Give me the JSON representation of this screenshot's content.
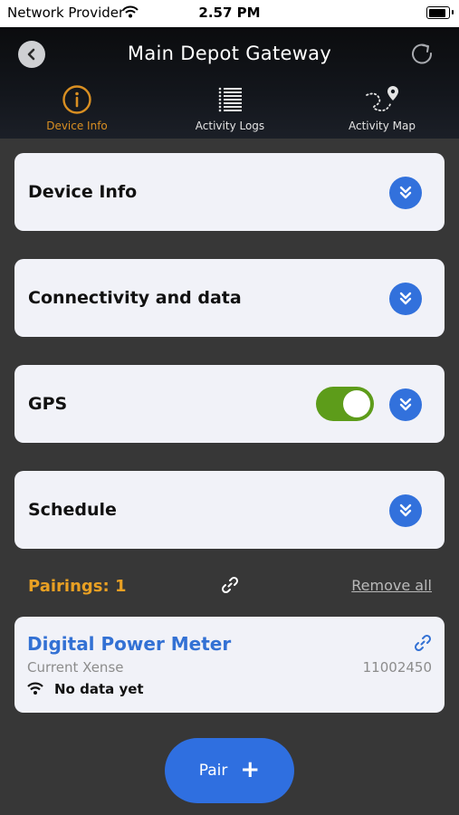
{
  "status_bar": {
    "carrier": "Network Provider",
    "time": "2.57 PM"
  },
  "header": {
    "title": "Main Depot Gateway",
    "tabs": [
      {
        "label": "Device Info",
        "icon": "info-icon",
        "active": true
      },
      {
        "label": "Activity Logs",
        "icon": "list-icon",
        "active": false
      },
      {
        "label": "Activity Map",
        "icon": "map-route-icon",
        "active": false
      }
    ]
  },
  "sections": [
    {
      "title": "Device Info"
    },
    {
      "title": "Connectivity and data"
    },
    {
      "title": "GPS",
      "toggle_on": true
    },
    {
      "title": "Schedule"
    }
  ],
  "pairings": {
    "label": "Pairings: 1",
    "remove_all": "Remove all",
    "items": [
      {
        "name": "Digital Power Meter",
        "type": "Current Xense",
        "serial": "11002450",
        "status": "No data yet"
      }
    ]
  },
  "pair_button": {
    "label": "Pair",
    "icon": "plus"
  },
  "colors": {
    "accent_orange": "#d98f22",
    "accent_blue": "#3271dc",
    "toggle_green": "#5d9c1a",
    "background": "#373737"
  }
}
